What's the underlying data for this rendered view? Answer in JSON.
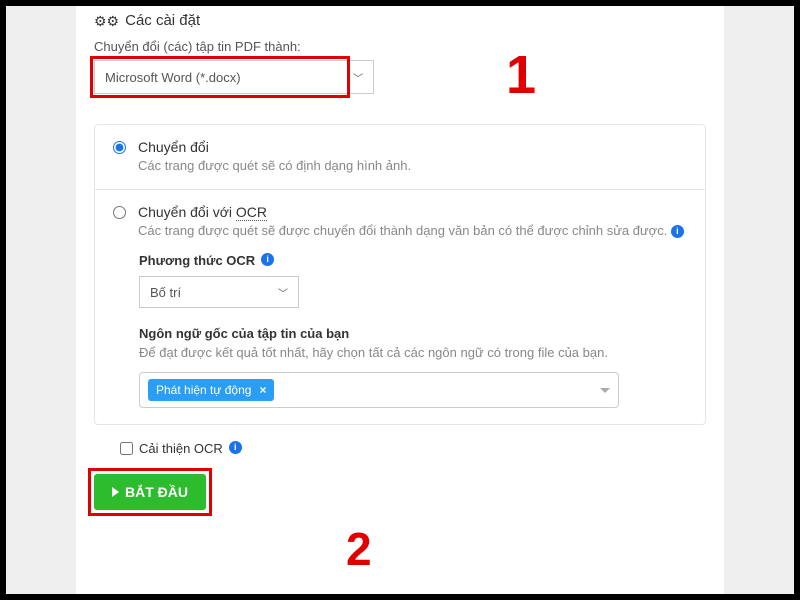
{
  "header": {
    "title": "Các cài đặt"
  },
  "convert": {
    "label": "Chuyển đổi (các) tập tin PDF thành:",
    "selected": "Microsoft Word (*.docx)"
  },
  "options": {
    "basic": {
      "title": "Chuyển đổi",
      "desc": "Các trang được quét sẽ có định dạng hình ảnh."
    },
    "ocr": {
      "title_prefix": "Chuyển đổi với ",
      "title_underline": "OCR",
      "desc": "Các trang được quét sẽ được chuyển đổi thành dạng văn bản có thể được chỉnh sửa được.",
      "method_label": "Phương thức OCR",
      "method_selected": "Bố trí",
      "lang_label": "Ngôn ngữ gốc của tập tin của bạn",
      "lang_help": "Để đạt được kết quả tốt nhất, hãy chọn tất cả các ngôn ngữ có trong file của bạn.",
      "lang_chip": "Phát hiện tự động"
    }
  },
  "improve_ocr_label": "Cải thiện OCR",
  "start_label": "BẮT ĐẦU",
  "markers": {
    "one": "1",
    "two": "2"
  }
}
